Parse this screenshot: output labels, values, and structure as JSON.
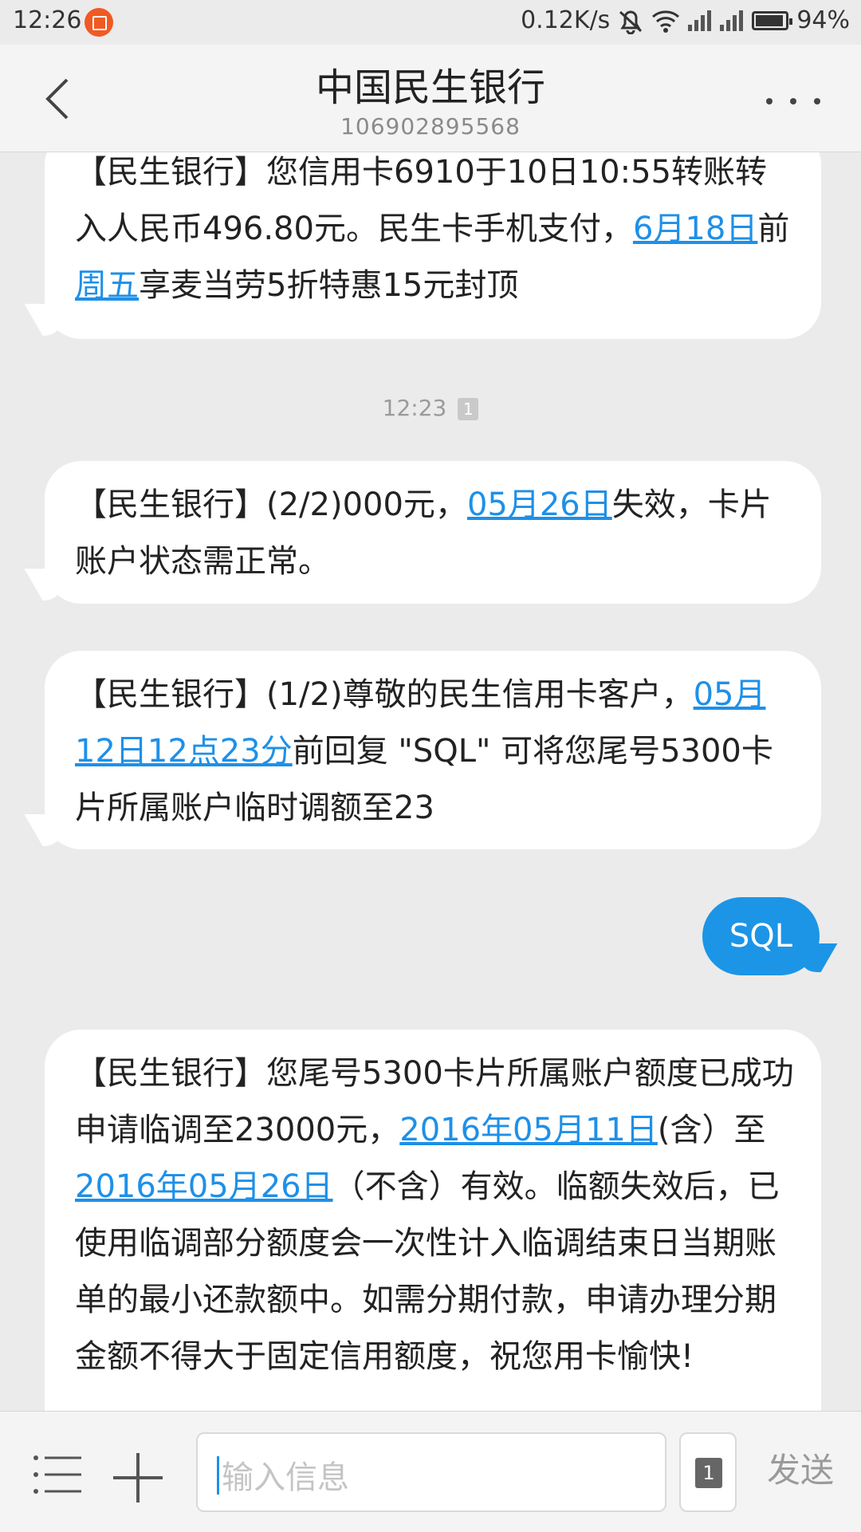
{
  "status_bar": {
    "time": "12:26",
    "speed": "0.12K/s",
    "battery": "94%",
    "icons": [
      "app-notification-icon",
      "bell-off-icon",
      "wifi-icon",
      "signal-icon",
      "signal-icon",
      "battery-icon"
    ]
  },
  "header": {
    "title": "中国民生银行",
    "number": "106902895568",
    "back_icon": "chevron-left-icon",
    "more_icon": "more-dots-icon"
  },
  "messages": {
    "m1": {
      "t1": "【民生银行】您信用卡6910于10日10:55转账转入人民币496.80元。民生卡手机支付，",
      "l1": "6月18日",
      "t2": "前",
      "l2": "周五",
      "t3": "享麦当劳5折特惠15元封顶"
    },
    "divider": {
      "time": "12:23",
      "sim": "1"
    },
    "m2": {
      "t1": "【民生银行】(2/2)000元，",
      "l1": "05月26日",
      "t2": "失效，卡片账户状态需正常。"
    },
    "m3": {
      "t1": "【民生银行】(1/2)尊敬的民生信用卡客户，",
      "l1": "05月12日12点23分",
      "t2": "前回复 \"SQL\" 可将您尾号5300卡片所属账户临时调额至23"
    },
    "reply": "SQL",
    "m4": {
      "t1": "【民生银行】您尾号5300卡片所属账户额度已成功申请临调至23000元，",
      "l1": "2016年05月11日",
      "t2": "(含）至",
      "l2": "2016年05月26日",
      "t3": "（不含）有效。临额失效后，已使用临调部分额度会一次性计入临调结束日当期账单的最小还款额中。如需分期付款，申请办理分期金额不得大于固定信用额度，祝您用卡愉快!"
    }
  },
  "input_bar": {
    "placeholder": "输入信息",
    "sim": "1",
    "send": "发送",
    "menu_icon": "list-icon",
    "add_icon": "plus-icon"
  },
  "colors": {
    "link": "#1e90e8",
    "outgoing_bubble": "#1c95e6",
    "background": "#ebebeb"
  }
}
